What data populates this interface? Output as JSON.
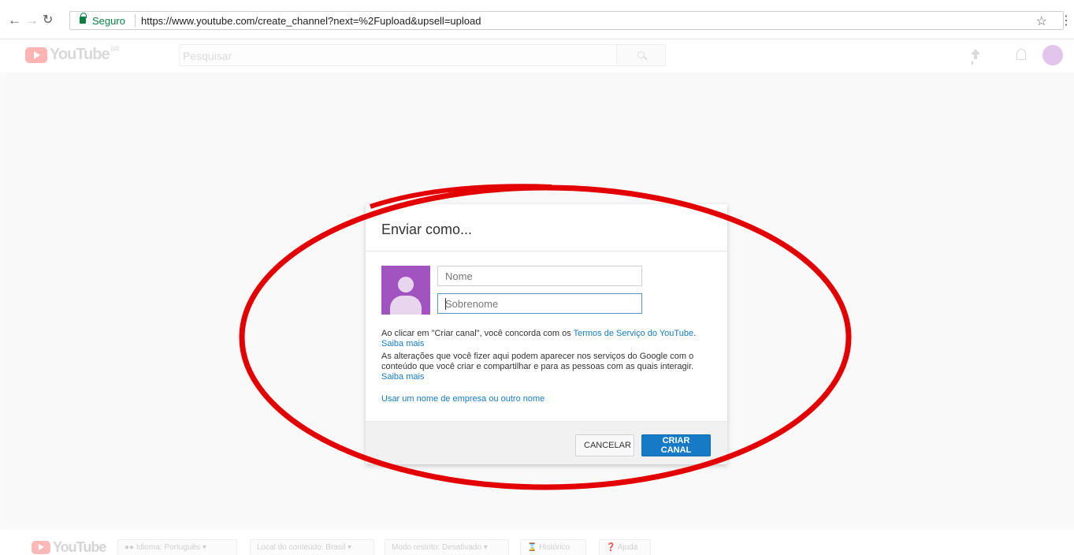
{
  "browser": {
    "secure_label": "Seguro",
    "url": "https://www.youtube.com/create_channel?next=%2Fupload&upsell=upload",
    "back_icon": "arrow-left-icon",
    "forward_icon": "arrow-right-icon",
    "reload_icon": "reload-icon",
    "bookmark_icon": "star-icon",
    "menu_icon": "more-vert-icon"
  },
  "masthead": {
    "logo_text": "YouTube",
    "country_code": "BR",
    "search_placeholder": "Pesquisar",
    "icons": [
      "search-icon",
      "upload-icon",
      "bell-icon",
      "avatar-icon"
    ]
  },
  "dialog": {
    "title": "Enviar como...",
    "first_name_placeholder": "Nome",
    "last_name_placeholder": "Sobrenome",
    "terms_prefix": "Ao clicar em \"Criar canal\", você concorda com os ",
    "terms_link": "Termos de Serviço do YouTube",
    "terms_suffix": ".",
    "learn_more_1": "Saiba mais",
    "changes_text": "As alterações que você fizer aqui podem aparecer nos serviços do Google com o conteúdo que você criar e compartilhar e para as pessoas com as quais interagir.",
    "learn_more_2": "Saiba mais",
    "other_name_link": "Usar um nome de empresa ou outro nome",
    "cancel_label": "CANCELAR",
    "create_label": "CRIAR CANAL"
  },
  "footer": {
    "logo_text": "YouTube",
    "language": "Idioma: Português",
    "content_location": "Local do conteúdo: Brasil",
    "restricted_mode": "Modo restrito: Desativado",
    "history": "Histórico",
    "help": "Ajuda"
  },
  "colors": {
    "accent_blue": "#167ac6",
    "annotation_red": "#e30000",
    "avatar_purple": "#a154c0"
  }
}
